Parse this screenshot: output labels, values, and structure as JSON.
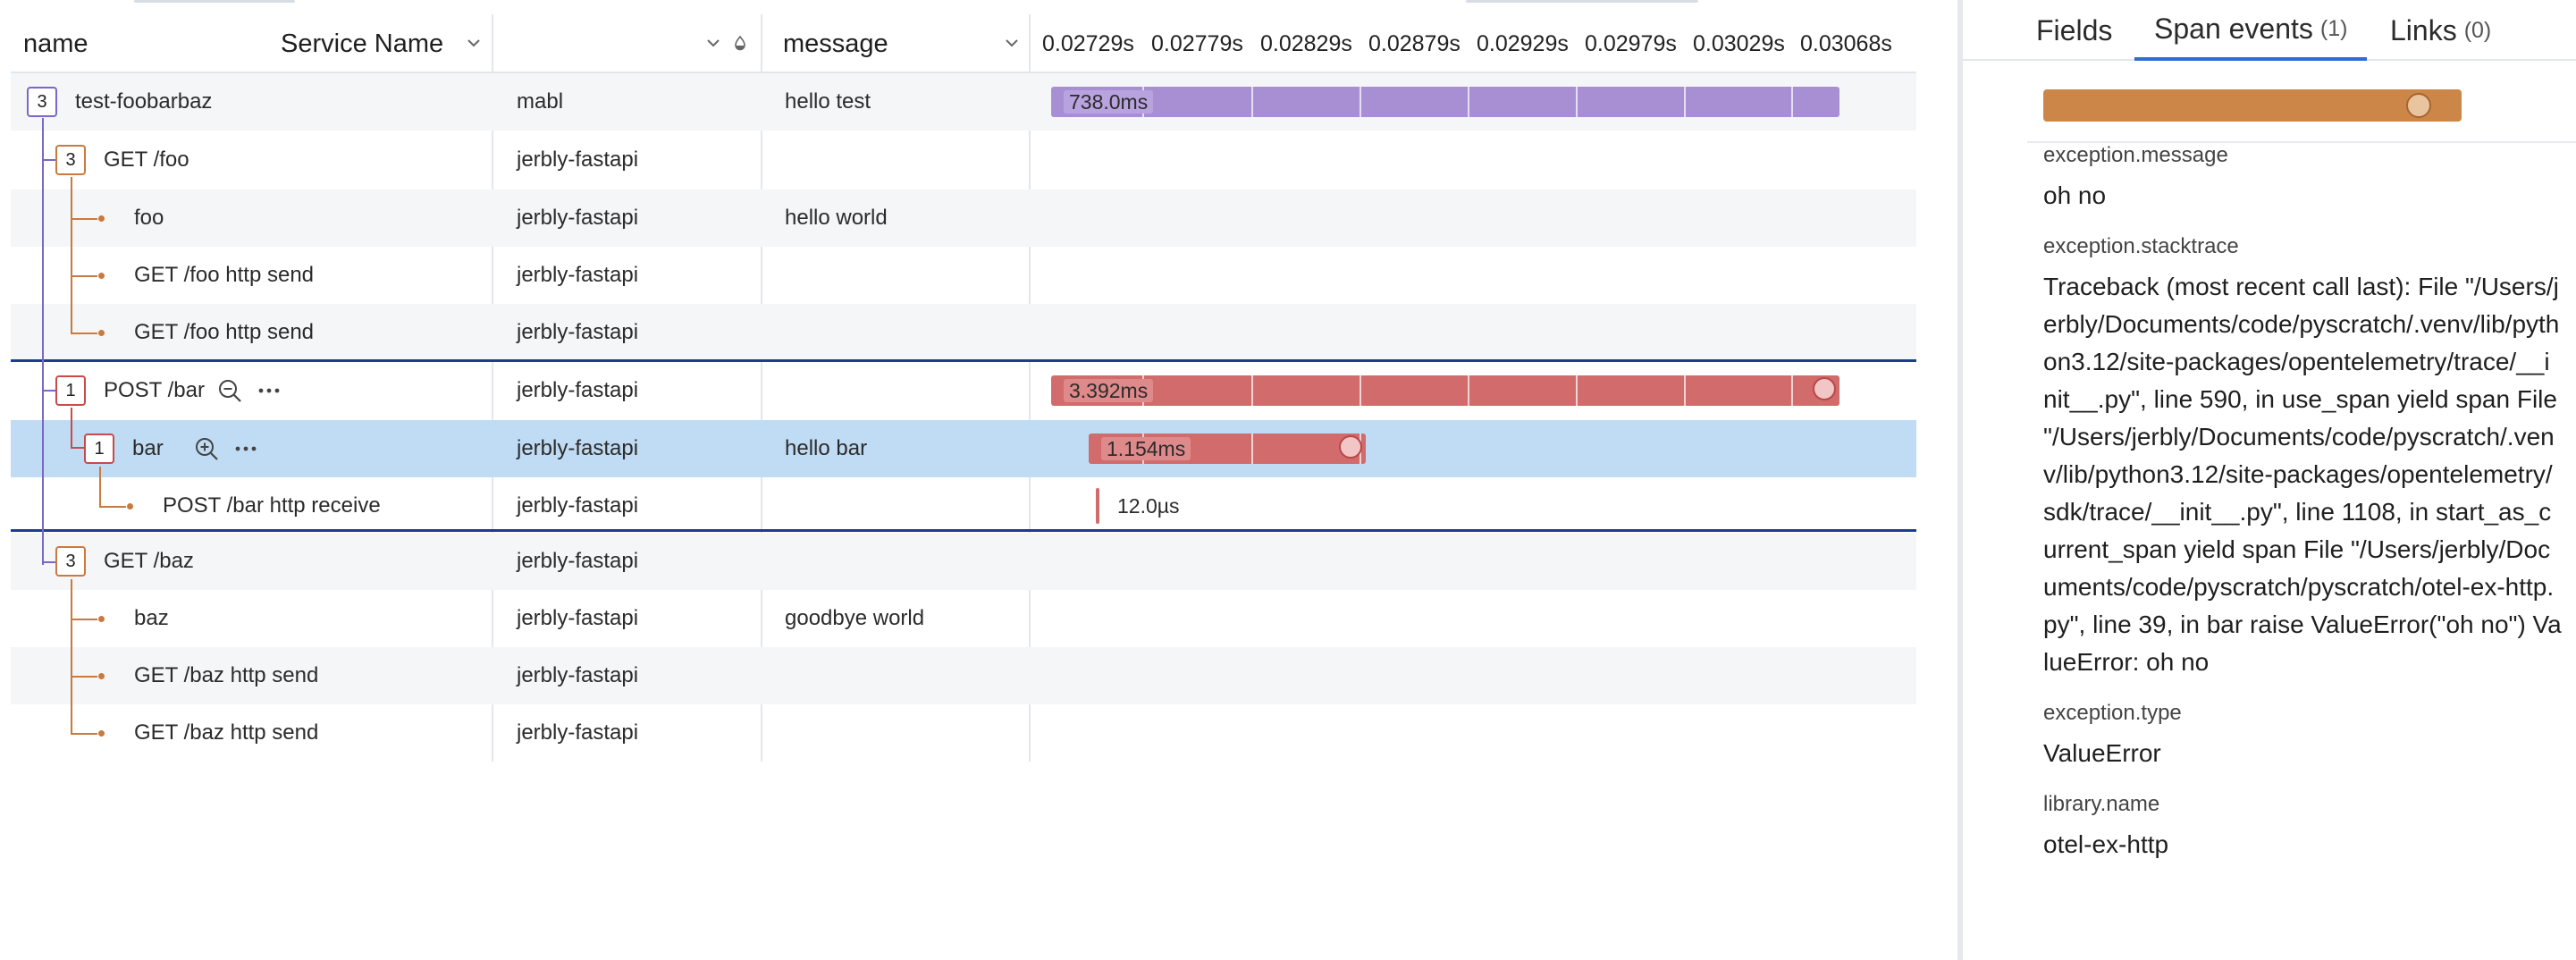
{
  "trace": {
    "columns": {
      "name": "name",
      "service": "Service Name",
      "message": "message"
    },
    "ticks": [
      "0.02729s",
      "0.02779s",
      "0.02829s",
      "0.02879s",
      "0.02929s",
      "0.02979s",
      "0.03029s",
      "0.03068s"
    ],
    "rows": [
      {
        "name": "test-foobarbaz",
        "service": "mabl",
        "message": "hello test",
        "badge": "3",
        "bar_label": "738.0ms"
      },
      {
        "name": "GET /foo",
        "service": "jerbly-fastapi",
        "message": "",
        "badge": "3"
      },
      {
        "name": "foo",
        "service": "jerbly-fastapi",
        "message": "hello world"
      },
      {
        "name": "GET /foo http send",
        "service": "jerbly-fastapi",
        "message": ""
      },
      {
        "name": "GET /foo http send",
        "service": "jerbly-fastapi",
        "message": ""
      },
      {
        "name": "POST /bar",
        "service": "jerbly-fastapi",
        "message": "",
        "badge": "1",
        "bar_label": "3.392ms"
      },
      {
        "name": "bar",
        "service": "jerbly-fastapi",
        "message": "hello bar",
        "badge": "1",
        "bar_label": "1.154ms"
      },
      {
        "name": "POST /bar http receive",
        "service": "jerbly-fastapi",
        "message": "",
        "bar_label": "12.0µs"
      },
      {
        "name": "GET /baz",
        "service": "jerbly-fastapi",
        "message": "",
        "badge": "3"
      },
      {
        "name": "baz",
        "service": "jerbly-fastapi",
        "message": "goodbye world"
      },
      {
        "name": "GET /baz http send",
        "service": "jerbly-fastapi",
        "message": ""
      },
      {
        "name": "GET /baz http send",
        "service": "jerbly-fastapi",
        "message": ""
      }
    ]
  },
  "detail": {
    "tabs": [
      {
        "label": "Fields",
        "count": ""
      },
      {
        "label": "Span events",
        "count": "(1)"
      },
      {
        "label": "Links",
        "count": "(0)"
      }
    ],
    "attributes": [
      {
        "key": "exception.message",
        "value": "oh no"
      },
      {
        "key": "exception.stacktrace",
        "value": "Traceback (most recent call last): File \"/Users/jerbly/Documents/code/pyscratch/.venv/lib/python3.12/site-packages/opentelemetry/trace/__init__.py\", line 590, in use_span yield span File \"/Users/jerbly/Documents/code/pyscratch/.venv/lib/python3.12/site-packages/opentelemetry/sdk/trace/__init__.py\", line 1108, in start_as_current_span yield span File \"/Users/jerbly/Documents/code/pyscratch/pyscratch/otel-ex-http.py\", line 39, in bar raise ValueError(\"oh no\") ValueError: oh no"
      },
      {
        "key": "exception.type",
        "value": "ValueError"
      },
      {
        "key": "library.name",
        "value": "otel-ex-http"
      }
    ]
  },
  "colors": {
    "purple_bar": "#a88fd4",
    "red_bar": "#d26b6b",
    "orange_tree": "#c97a3e",
    "selected_row": "#c0dbf4",
    "separator": "#1d3b8f",
    "active_tab": "#2d6fd0"
  }
}
